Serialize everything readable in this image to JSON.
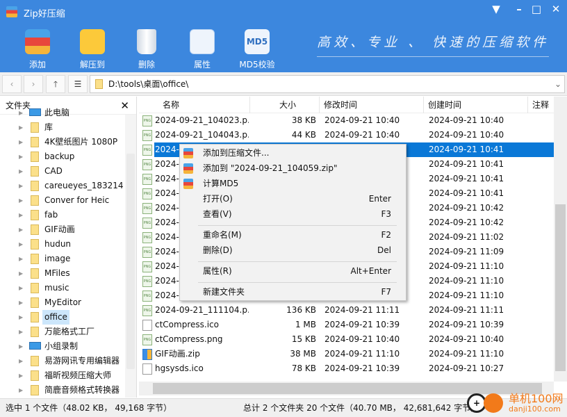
{
  "app": {
    "title": "Zip好压缩",
    "slogan": "高效、专业 、 快速的压缩软件"
  },
  "window_controls": {
    "menu": "▼",
    "minimize": "–",
    "maximize": "□",
    "close": "✕"
  },
  "toolbar": [
    {
      "label": "添加",
      "icon": "archive-add-icon"
    },
    {
      "label": "解压到",
      "icon": "folder-extract-icon"
    },
    {
      "label": "删除",
      "icon": "trash-icon"
    },
    {
      "label": "属性",
      "icon": "sliders-icon"
    },
    {
      "label": "MD5校验",
      "icon": "md5-icon",
      "badge": "MD5"
    }
  ],
  "address": {
    "back": "‹",
    "forward": "›",
    "up": "🡑",
    "view": "☰",
    "path": "D:\\tools\\桌面\\office\\",
    "dropdown": "⌄"
  },
  "folders": {
    "title": "文件夹",
    "close": "✕",
    "items": [
      {
        "label": "此电脑",
        "icon": "pc"
      },
      {
        "label": "库",
        "icon": "library"
      },
      {
        "label": "4K壁纸图片 1080P"
      },
      {
        "label": "backup",
        "icon": "network"
      },
      {
        "label": "CAD"
      },
      {
        "label": "careueyes_183214"
      },
      {
        "label": "Conver for Heic"
      },
      {
        "label": "fab"
      },
      {
        "label": "GIF动画"
      },
      {
        "label": "hudun"
      },
      {
        "label": "image"
      },
      {
        "label": "MFiles"
      },
      {
        "label": "music"
      },
      {
        "label": "MyEditor"
      },
      {
        "label": "office",
        "selected": true
      },
      {
        "label": "万能格式工厂"
      },
      {
        "label": "小组录制",
        "icon": "pc"
      },
      {
        "label": "易游网讯专用编辑器"
      },
      {
        "label": "福昕视频压缩大师"
      },
      {
        "label": "简鹿音频格式转换器"
      }
    ]
  },
  "columns": {
    "name": "名称",
    "size": "大小",
    "modified": "修改时间",
    "created": "创建时间",
    "note": "注释"
  },
  "files": [
    {
      "name": "2024-09-21_104023.p...",
      "size": "38 KB",
      "modified": "2024-09-21 10:40",
      "created": "2024-09-21 10:40",
      "type": "png"
    },
    {
      "name": "2024-09-21_104043.p...",
      "size": "44 KB",
      "modified": "2024-09-21 10:40",
      "created": "2024-09-21 10:40",
      "type": "png"
    },
    {
      "name": "2024-",
      "size": "",
      "modified": "",
      "created": "2024-09-21 10:41",
      "type": "png",
      "selected": true
    },
    {
      "name": "2024-",
      "size": "",
      "modified": "",
      "created": "2024-09-21 10:41",
      "type": "png"
    },
    {
      "name": "2024-",
      "size": "",
      "modified": "",
      "created": "2024-09-21 10:41",
      "type": "png"
    },
    {
      "name": "2024-",
      "size": "",
      "modified": "",
      "created": "2024-09-21 10:41",
      "type": "png"
    },
    {
      "name": "2024-",
      "size": "",
      "modified": "",
      "created": "2024-09-21 10:42",
      "type": "png"
    },
    {
      "name": "2024-",
      "size": "",
      "modified": "",
      "created": "2024-09-21 10:42",
      "type": "png"
    },
    {
      "name": "2024-",
      "size": "",
      "modified": "",
      "created": "2024-09-21 11:02",
      "type": "png"
    },
    {
      "name": "2024-",
      "size": "",
      "modified": "",
      "created": "2024-09-21 11:09",
      "type": "png"
    },
    {
      "name": "2024-",
      "size": "",
      "modified": "",
      "created": "2024-09-21 11:10",
      "type": "png"
    },
    {
      "name": "2024-",
      "size": "",
      "modified": "",
      "created": "2024-09-21 11:10",
      "type": "png"
    },
    {
      "name": "2024-",
      "size": "",
      "modified": "",
      "created": "2024-09-21 11:10",
      "type": "png"
    },
    {
      "name": "2024-09-21_111104.p...",
      "size": "136 KB",
      "modified": "2024-09-21 11:11",
      "created": "2024-09-21 11:11",
      "type": "png"
    },
    {
      "name": "ctCompress.ico",
      "size": "1 MB",
      "modified": "2024-09-21 10:39",
      "created": "2024-09-21 10:39",
      "type": "ico"
    },
    {
      "name": "ctCompress.png",
      "size": "15 KB",
      "modified": "2024-09-21 10:40",
      "created": "2024-09-21 10:40",
      "type": "png"
    },
    {
      "name": "GIF动画.zip",
      "size": "38 MB",
      "modified": "2024-09-21 11:10",
      "created": "2024-09-21 11:10",
      "type": "zip"
    },
    {
      "name": "hgsysds.ico",
      "size": "78 KB",
      "modified": "2024-09-21 10:39",
      "created": "2024-09-21 10:27",
      "type": "ico"
    }
  ],
  "context_menu": [
    {
      "label": "添加到压缩文件...",
      "shortcut": "",
      "icon": true
    },
    {
      "label": "添加到 \"2024-09-21_104059.zip\"",
      "shortcut": "",
      "icon": true
    },
    {
      "label": "计算MD5",
      "shortcut": "",
      "icon": true
    },
    {
      "label": "打开(O)",
      "shortcut": "Enter"
    },
    {
      "label": "查看(V)",
      "shortcut": "F3",
      "sep_after": true
    },
    {
      "label": "重命名(M)",
      "shortcut": "F2"
    },
    {
      "label": "删除(D)",
      "shortcut": "Del",
      "sep_after": true
    },
    {
      "label": "属性(R)",
      "shortcut": "Alt+Enter",
      "sep_after": true
    },
    {
      "label": "新建文件夹",
      "shortcut": "F7"
    }
  ],
  "status": {
    "selection": "选中 1 个文件（48.02 KB， 49,168 字节）",
    "total": "总计 2 个文件夹 20 个文件（40.70 MB， 42,681,642 字节）"
  },
  "watermark": {
    "text": "单机100网",
    "url": "danji100.com"
  },
  "colors": {
    "accent": "#3c87de",
    "selection": "#0a78d7",
    "folder": "#fbe08a"
  }
}
